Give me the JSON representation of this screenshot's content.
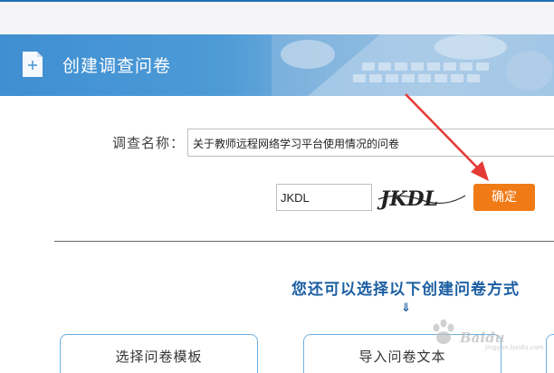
{
  "header": {
    "title": "创建调查问卷",
    "icon": "add-document-icon"
  },
  "form": {
    "name_label": "调查名称：",
    "name_value": "关于教师远程网络学习平台使用情况的问卷",
    "captcha_value": "JKDL",
    "captcha_image_text": "JKDL",
    "confirm_label": "确定"
  },
  "section": {
    "title": "您还可以选择以下创建问卷方式",
    "arrow": "⇓",
    "cards": [
      {
        "label": "选择问卷模板"
      },
      {
        "label": "导入问卷文本"
      }
    ]
  },
  "watermark": {
    "text": "Baidu",
    "sub": "jingyan.baidu.com"
  },
  "colors": {
    "accent": "#f07b16",
    "banner": "#4d9ad6",
    "section_title": "#1c5fa2",
    "annotation_arrow": "#e53935"
  }
}
